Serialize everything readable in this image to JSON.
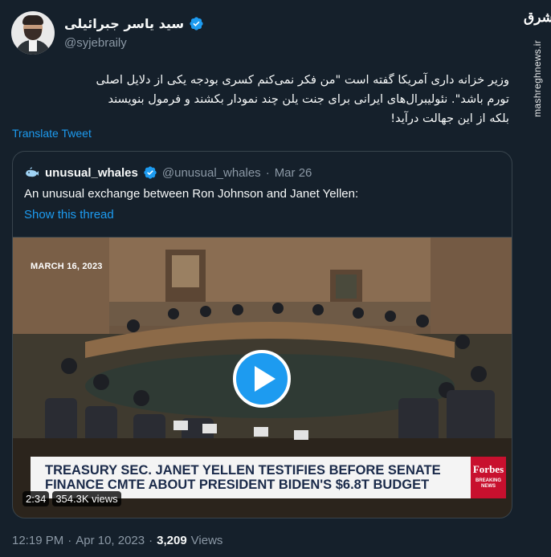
{
  "author": {
    "display_name": "سید یاسر جبرائیلی",
    "handle": "@syjebraily",
    "verified": true
  },
  "tweet": {
    "text": "وزیر خزانه داری آمریکا گفته است \"من فکر نمی‌کنم کسری بودجه یکی از دلایل اصلی\nتورم باشد\". نئولیبرال‌های ایرانی برای جنت یلن چند نمودار بکشند و فرمول بنویسند\nبلکه از این جهالت درآید!",
    "translate_label": "Translate Tweet"
  },
  "quote": {
    "author_name": "unusual_whales",
    "author_handle": "@unusual_whales",
    "separator": "·",
    "date": "Mar 26",
    "text": "An unusual exchange between Ron Johnson and Janet Yellen:",
    "show_thread": "Show this thread"
  },
  "video": {
    "date_stamp": "MARCH 16, 2023",
    "chyron_line1": "TREASURY SEC. JANET YELLEN TESTIFIES BEFORE SENATE",
    "chyron_line2": "FINANCE CMTE ABOUT PRESIDENT BIDEN'S $6.8T BUDGET",
    "network_name": "Forbes",
    "network_sub": "BREAKING NEWS",
    "duration": "2:34",
    "views": "354.3K views"
  },
  "meta": {
    "time": "12:19 PM",
    "separator1": "·",
    "date": "Apr 10, 2023",
    "separator2": "·",
    "view_count": "3,209",
    "views_label": "Views"
  },
  "watermark": {
    "logo": "مشرق",
    "site": "mashreghnews.ir"
  },
  "colors": {
    "background": "#15202b",
    "accent": "#1d9bf0",
    "muted": "#8b98a5",
    "border": "#38444d"
  }
}
